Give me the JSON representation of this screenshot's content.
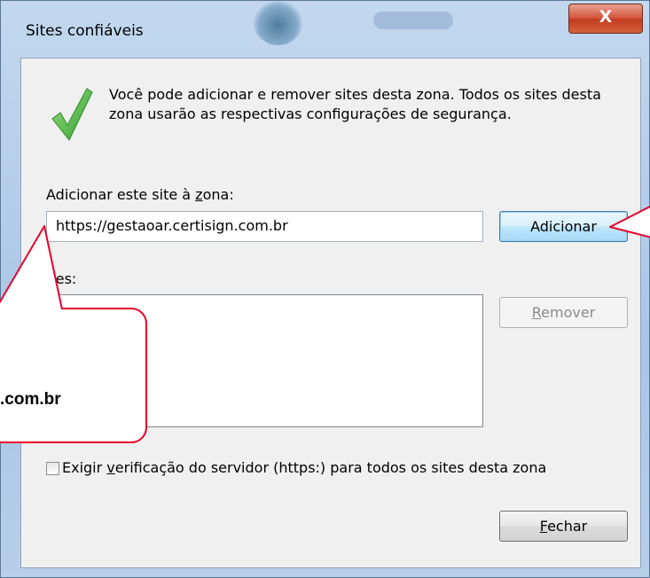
{
  "window": {
    "title": "Sites confiáveis",
    "close_glyph": "X"
  },
  "info": {
    "message": "Você pode adicionar e remover sites desta zona. Todos os sites desta zona usarão as respectivas configurações de segurança.",
    "icon": "green-check-icon"
  },
  "add_site": {
    "label_before": "Adicionar este site à ",
    "label_underlined": "z",
    "label_after": "ona:",
    "url_value": "https://gestaoar.certisign.com.br",
    "add_button": "Adicionar"
  },
  "sites": {
    "label": "ites:",
    "remove_button_underlined": "R",
    "remove_button_rest": "emover"
  },
  "https_check": {
    "label_before": "Exigir ",
    "label_underlined": "v",
    "label_after": "erificação do servidor (https:) para todos os sites desta zona",
    "checked": false
  },
  "close_button": {
    "underlined": "F",
    "rest": "echar"
  },
  "callout": {
    "text": ".com.br"
  },
  "colors": {
    "callout_red": "#e8002a",
    "check_green": "#3bb33b"
  }
}
